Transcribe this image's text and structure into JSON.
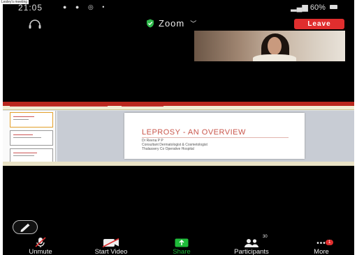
{
  "caption": "Lesley's meeting",
  "status_bar": {
    "time": "21:05",
    "battery": "60%"
  },
  "top_bar": {
    "title": "Zoom",
    "leave_label": "Leave"
  },
  "shared_slide": {
    "title": "LEPROSY - AN OVERVIEW",
    "presenter": "Dr Reena P P",
    "role": "Consultant Dermatologist & Cosmetologist",
    "hospital": "Thalassery Co Operative Hospital"
  },
  "toolbar": {
    "unmute": "Unmute",
    "start_video": "Start Video",
    "share": "Share",
    "participants": "Participants",
    "participants_count": "30",
    "more": "More",
    "more_badge": "1"
  },
  "colors": {
    "leave": "#e02e2e",
    "share": "#1fbb3a",
    "background": "#000000"
  }
}
